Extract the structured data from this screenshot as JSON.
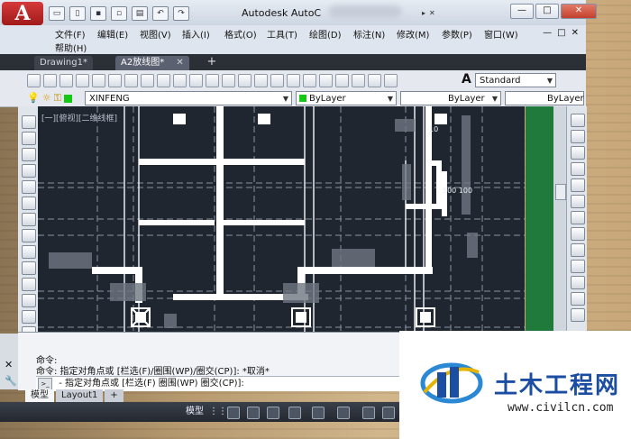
{
  "window": {
    "title": "Autodesk AutoC",
    "controls": [
      "—",
      "□",
      "✕"
    ]
  },
  "qat": [
    "new",
    "open",
    "save",
    "save-as",
    "plot",
    "undo",
    "redo"
  ],
  "menu": {
    "row1": [
      "文件(F)",
      "编辑(E)",
      "视图(V)",
      "插入(I)",
      "格式(O)",
      "工具(T)",
      "绘图(D)",
      "标注(N)",
      "修改(M)",
      "参数(P)",
      "窗口(W)"
    ],
    "row2": [
      "帮助(H)"
    ],
    "controls": [
      "—",
      "□",
      "✕"
    ]
  },
  "tabs": [
    {
      "label": "Drawing1*",
      "active": false
    },
    {
      "label": "A2放线图*",
      "active": true
    }
  ],
  "tab_close": "✕",
  "tab_add": "+",
  "toolbar1": {
    "text_style_value": "Standard",
    "text_icon": "A"
  },
  "toolbar2": {
    "layer_value": "XINFENG",
    "color_value": "ByLayer",
    "linetype_value": "ByLayer",
    "lineweight_value": "ByLayer"
  },
  "canvas": {
    "viewport_label": "[一][俯视][二维线框]",
    "dimension_text": "500 100",
    "dimension_text2": "10"
  },
  "command": {
    "line1": "命令:",
    "line2": "命令: 指定对角点或 [栏选(F)/圈围(WP)/圈交(CP)]: *取消*",
    "input": "- 指定对角点或 [栏选(F) 圈围(WP) 圈交(CP)]:",
    "prompt_icon": ">_"
  },
  "model_tabs": [
    {
      "label": "模型",
      "active": true
    },
    {
      "label": "Layout1",
      "active": false
    }
  ],
  "model_add": "+",
  "statusbar": {
    "model_label": "模型",
    "grid_icon": "⋮⋮⋮"
  },
  "watermark": {
    "title": "土木工程网",
    "url": "www.civilcn.com"
  }
}
